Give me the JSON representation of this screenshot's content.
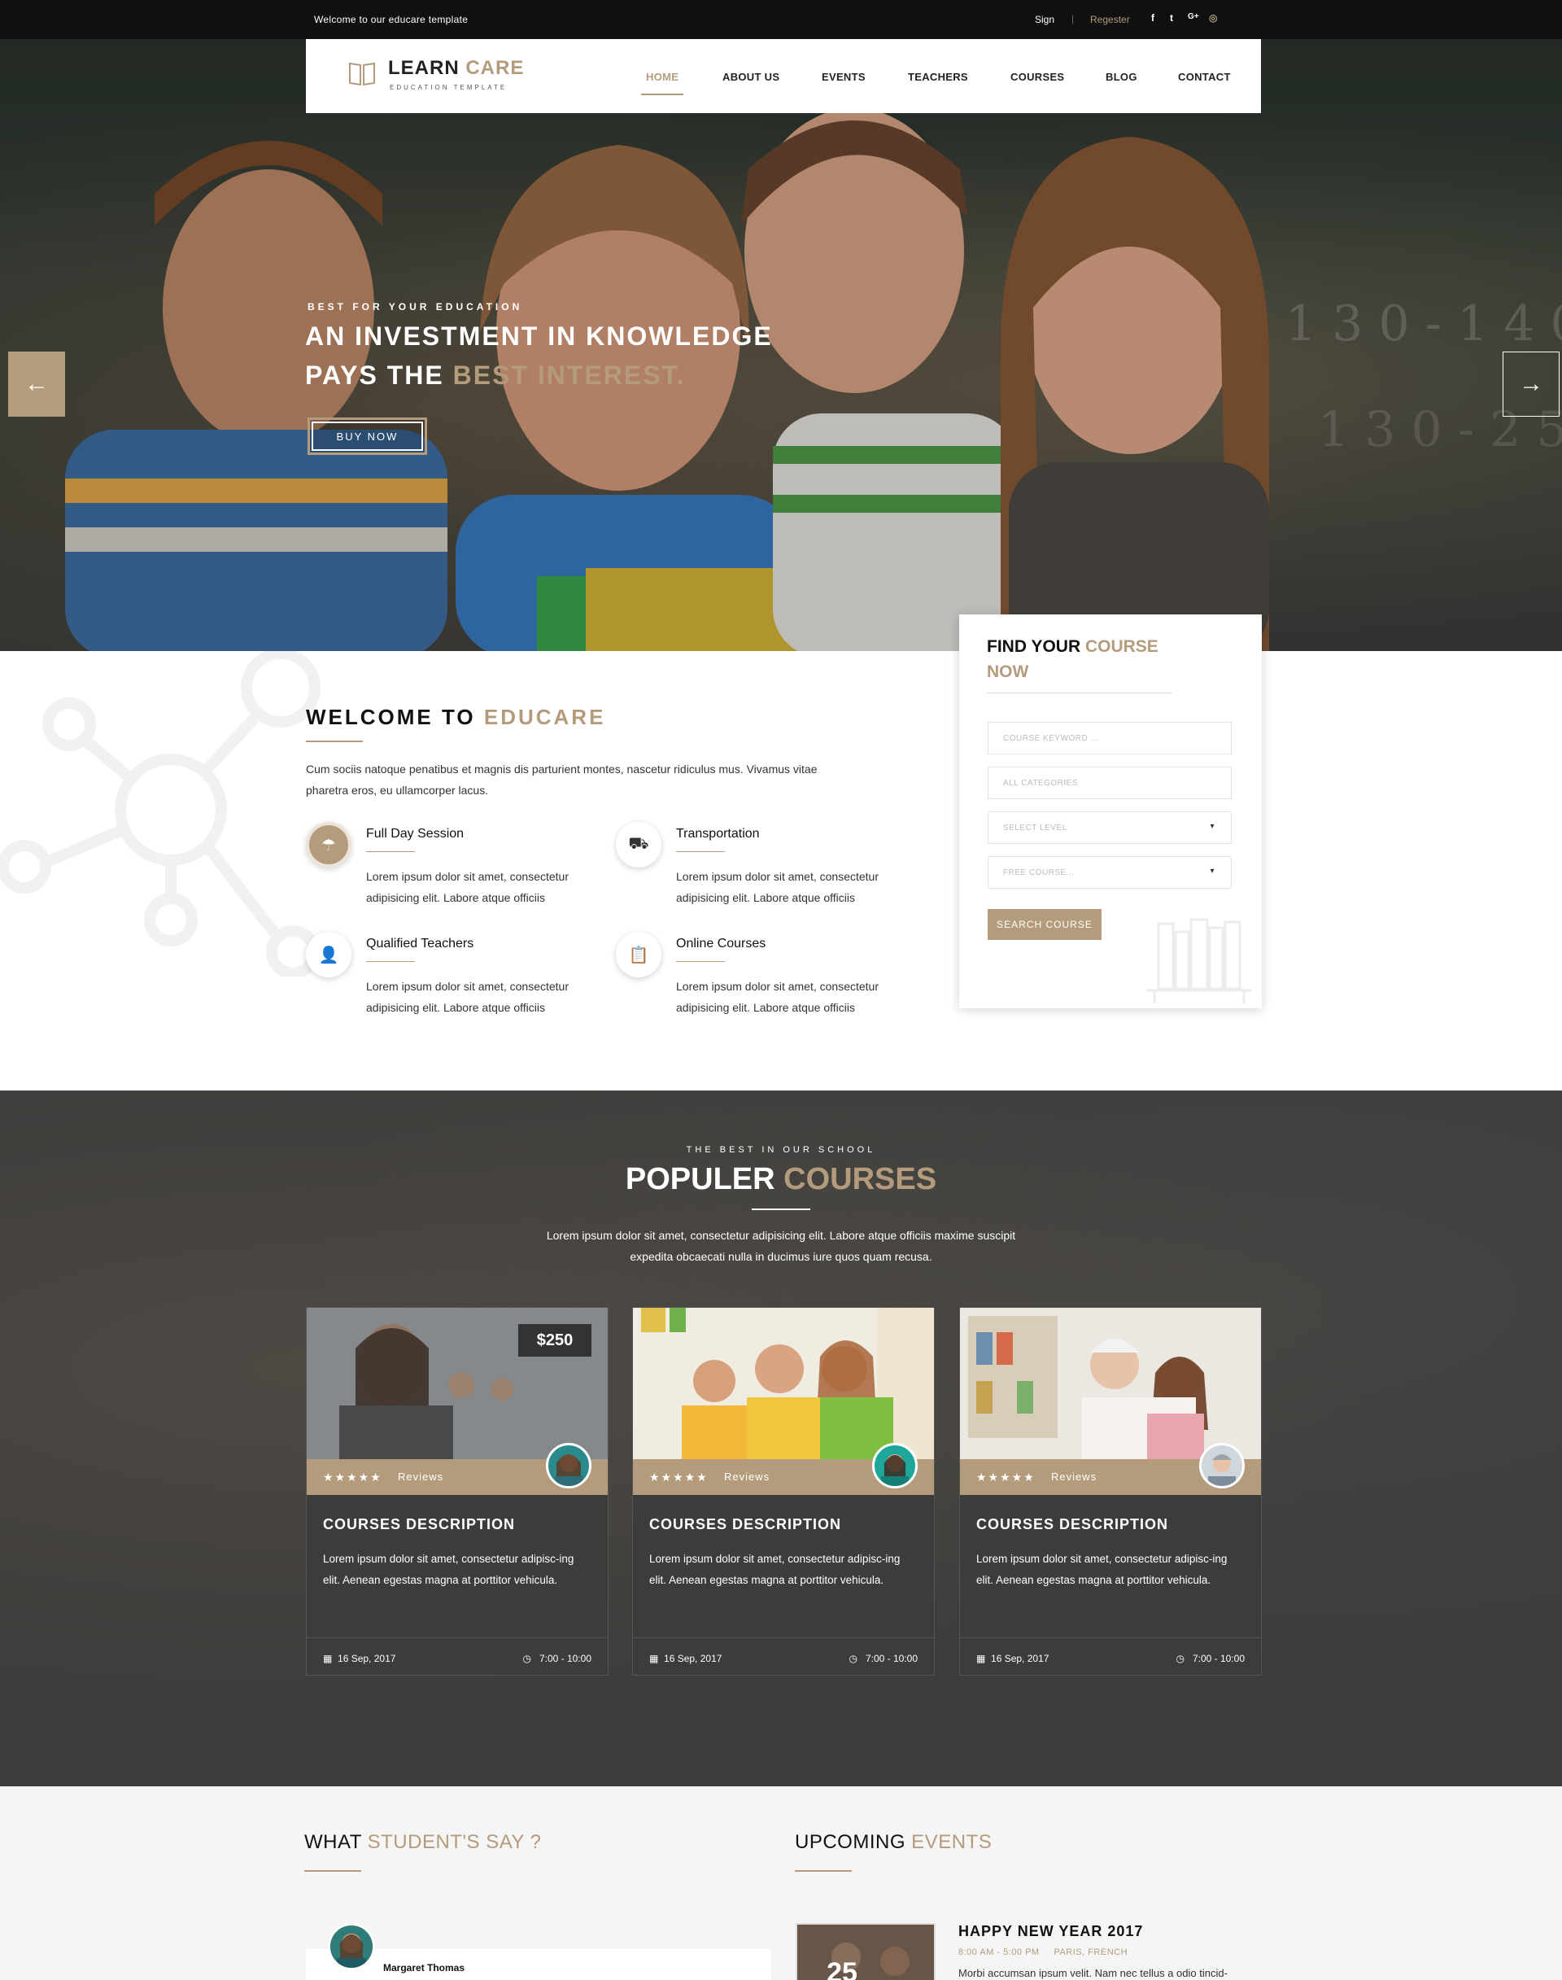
{
  "topbar": {
    "welcome": "Welcome to our educare template",
    "sign": "Sign",
    "separator": "|",
    "register": "Regester",
    "social": [
      "f",
      "t",
      "G+",
      "◎"
    ]
  },
  "brand": {
    "name_part1": "LEARN ",
    "name_part2": "CARE",
    "tagline": "EDUCATION TEMPLATE",
    "icon": "open-book-icon"
  },
  "nav": {
    "items": [
      "HOME",
      "ABOUT US",
      "EVENTS",
      "TEACHERS",
      "COURSES",
      "BLOG",
      "CONTACT"
    ],
    "active": "HOME"
  },
  "hero": {
    "pre_title": "BEST FOR YOUR EDUCATION",
    "line1": "AN INVESTMENT IN KNOWLEDGE",
    "line2_a": "PAYS THE ",
    "line2_b": "BEST INTEREST.",
    "button": "BUY NOW",
    "prev_arrow": "←",
    "next_arrow": "→"
  },
  "welcome": {
    "title_a": "WELCOME TO ",
    "title_b": "EDUCARE",
    "text": "Cum sociis natoque penatibus et magnis dis parturient montes, nascetur ridiculus mus. Vivamus vitae pharetra eros, eu ullamcorper lacus.",
    "features": [
      {
        "title": "Full Day Session",
        "text": "Lorem ipsum dolor sit amet, consectetur adipisicing elit. Labore atque officiis",
        "icon": "umbrella-icon"
      },
      {
        "title": "Transportation",
        "text": "Lorem ipsum dolor sit amet, consectetur adipisicing elit. Labore atque officiis",
        "icon": "bus-icon"
      },
      {
        "title": "Qualified Teachers",
        "text": "Lorem ipsum dolor sit amet, consectetur adipisicing elit. Labore atque officiis",
        "icon": "user-icon"
      },
      {
        "title": "Online Courses",
        "text": "Lorem ipsum dolor sit amet, consectetur adipisicing elit. Labore atque officiis",
        "icon": "clipboard-icon"
      }
    ]
  },
  "find_course": {
    "title_a": "FIND YOUR ",
    "title_b": "COURSE",
    "title_c": "NOW",
    "keyword_placeholder": "COURSE KEYWORD ...",
    "category_placeholder": "ALL CATEGORIES",
    "level_placeholder": "SELECT LEVEL",
    "fee_placeholder": "FREE COURSE...",
    "caret": "▾",
    "button": "SEARCH COURSE"
  },
  "popular": {
    "pre_title": "THE BEST IN OUR SCHOOL",
    "title_a": "POPULER ",
    "title_b": "COURSES",
    "desc": "Lorem ipsum dolor sit amet, consectetur adipisicing elit. Labore atque officiis maxime suscipit expedita obcaecati nulla in ducimus iure quos quam recusa.",
    "cards": [
      {
        "price": "$250",
        "stars": "★★★★★",
        "reviews": "Reviews",
        "title": "COURSES DESCRIPTION",
        "text": "Lorem ipsum dolor sit amet, consectetur adipisc-ing elit. Aenean egestas magna at porttitor vehicula.",
        "date": "16 Sep, 2017",
        "time": "7:00 - 10:00"
      },
      {
        "price": "",
        "stars": "★★★★★",
        "reviews": "Reviews",
        "title": "COURSES DESCRIPTION",
        "text": "Lorem ipsum dolor sit amet, consectetur adipisc-ing elit. Aenean egestas magna at porttitor vehicula.",
        "date": "16 Sep, 2017",
        "time": "7:00 - 10:00"
      },
      {
        "price": "",
        "stars": "★★★★★",
        "reviews": "Reviews",
        "title": "COURSES DESCRIPTION",
        "text": "Lorem ipsum dolor sit amet, consectetur adipisc-ing elit. Aenean egestas magna at porttitor vehicula.",
        "date": "16 Sep, 2017",
        "time": "7:00 - 10:00"
      }
    ]
  },
  "testimonials": {
    "title_a": "WHAT ",
    "title_b": "STUDENT'S SAY ?",
    "name": "Margaret Thomas"
  },
  "events": {
    "title_a": "UPCOMING ",
    "title_b": "EVENTS",
    "day": "25",
    "event_title": "HAPPY NEW YEAR 2017",
    "time": "8:00 AM - 5:00 PM",
    "place": "PARIS, FRENCH",
    "text": "Morbi accumsan ipsum velit. Nam nec tellus a odio tincid-"
  },
  "colors": {
    "accent": "#b49b7c",
    "dark": "#3c3c3b",
    "topbar": "#101010"
  }
}
